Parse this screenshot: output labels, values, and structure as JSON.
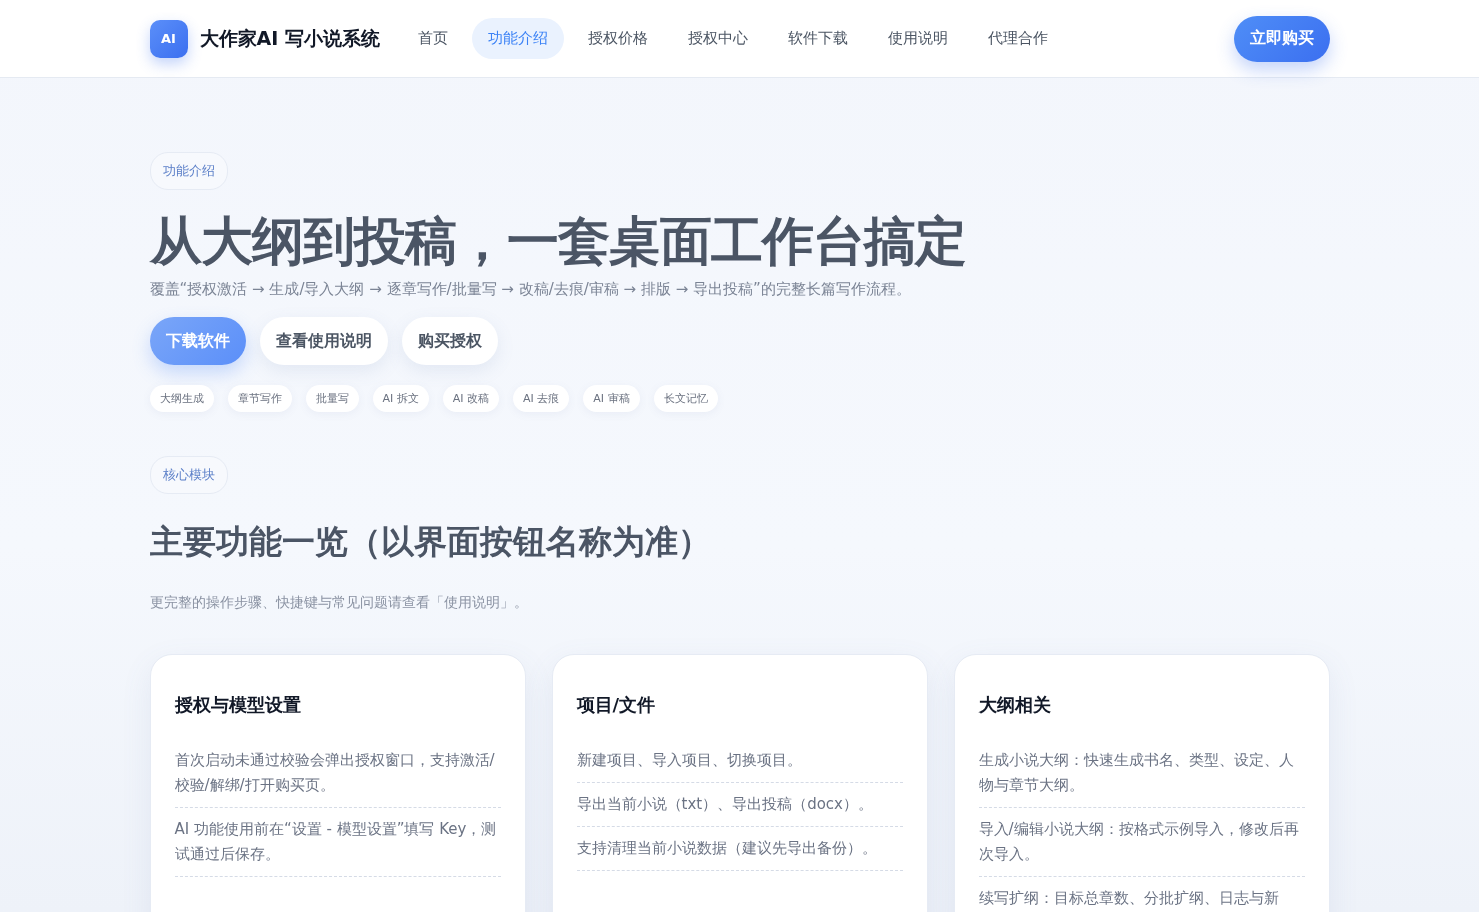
{
  "nav": {
    "logo_badge": "AI",
    "brand": "大作家AI 写小说系统",
    "items": [
      {
        "label": "首页",
        "selected": false
      },
      {
        "label": "功能介绍",
        "selected": true
      },
      {
        "label": "授权价格",
        "selected": false
      },
      {
        "label": "授权中心",
        "selected": false
      },
      {
        "label": "软件下载",
        "selected": false
      },
      {
        "label": "使用说明",
        "selected": false
      },
      {
        "label": "代理合作",
        "selected": false
      }
    ],
    "cta": "立即购买"
  },
  "hero": {
    "eyebrow": "功能介绍",
    "title": "从大纲到投稿，一套桌面工作台搞定",
    "subtitle": "覆盖“授权激活 → 生成/导入大纲 → 逐章写作/批量写 → 改稿/去痕/审稿 → 排版 → 导出投稿”的完整长篇写作流程。",
    "buttons": [
      {
        "label": "下载软件",
        "kind": "primary"
      },
      {
        "label": "查看使用说明",
        "kind": "secondary"
      },
      {
        "label": "购买授权",
        "kind": "secondary"
      }
    ],
    "tags": [
      "大纲生成",
      "章节写作",
      "批量写",
      "AI 拆文",
      "AI 改稿",
      "AI 去痕",
      "AI 审稿",
      "长文记忆"
    ]
  },
  "section": {
    "eyebrow": "核心模块",
    "title": "主要功能一览（以界面按钮名称为准）",
    "subtitle": "更完整的操作步骤、快捷键与常见问题请查看「使用说明」。",
    "cards": [
      {
        "title": "授权与模型设置",
        "items": [
          "首次启动未通过校验会弹出授权窗口，支持激活/校验/解绑/打开购买页。",
          "AI 功能使用前在“设置 - 模型设置”填写 Key，测试通过后保存。"
        ]
      },
      {
        "title": "项目/文件",
        "items": [
          "新建项目、导入项目、切换项目。",
          "导出当前小说（txt）、导出投稿（docx）。",
          "支持清理当前小说数据（建议先导出备份）。"
        ]
      },
      {
        "title": "大纲相关",
        "items": [
          "生成小说大纲：快速生成书名、类型、设定、人物与章节大纲。",
          "导入/编辑小说大纲：按格式示例导入，修改后再次导入。",
          "续写扩纲：目标总章数、分批扩纲、日志与新"
        ]
      }
    ]
  }
}
